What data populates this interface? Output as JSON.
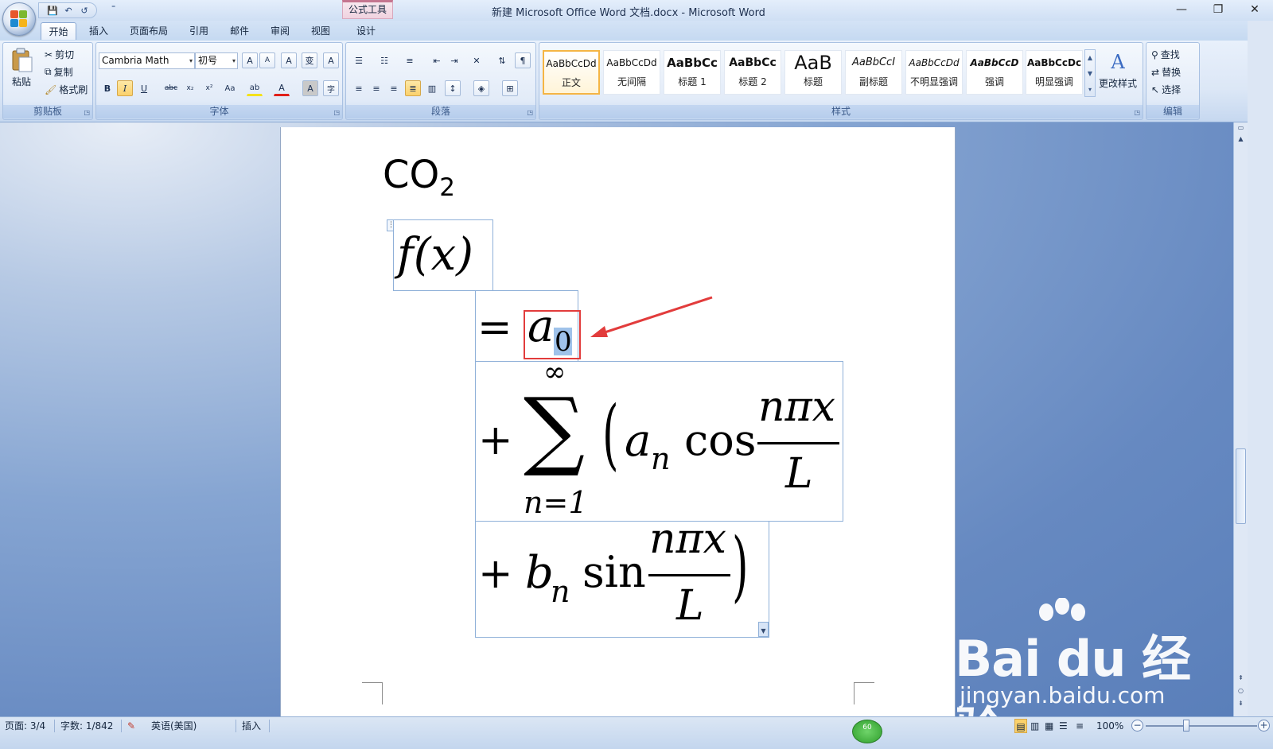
{
  "window": {
    "title": "新建 Microsoft Office Word 文档.docx - Microsoft Word",
    "context_tool": "公式工具",
    "controls": {
      "minimize": "—",
      "restore": "❐",
      "close": "✕"
    }
  },
  "qat": {
    "save": "💾",
    "undo": "↶",
    "redo": "↺",
    "more": "⁼"
  },
  "tabs": [
    {
      "label": "开始",
      "active": true
    },
    {
      "label": "插入"
    },
    {
      "label": "页面布局"
    },
    {
      "label": "引用"
    },
    {
      "label": "邮件"
    },
    {
      "label": "审阅"
    },
    {
      "label": "视图"
    },
    {
      "label": "设计",
      "context": true
    }
  ],
  "ribbon": {
    "clipboard": {
      "label": "剪贴板",
      "paste": "粘贴",
      "cut": "剪切",
      "copy": "复制",
      "format_painter": "格式刷"
    },
    "font": {
      "label": "字体",
      "font_name": "Cambria Math",
      "font_size": "初号",
      "bold": "B",
      "italic": "I",
      "underline": "U",
      "strike": "abc",
      "subscript": "x₂",
      "superscript": "x²",
      "change_case": "Aa",
      "grow": "A",
      "shrink": "A",
      "clear": "A",
      "phonetic": "变",
      "border_char": "A",
      "highlight": "ab",
      "font_color": "A",
      "shade_char": "A",
      "enclose": "字"
    },
    "paragraph": {
      "label": "段落"
    },
    "styles": {
      "label": "样式",
      "items": [
        {
          "preview": "AaBbCcDd",
          "label": "正文",
          "selected": true
        },
        {
          "preview": "AaBbCcDd",
          "label": "无间隔"
        },
        {
          "preview": "AaBbCc",
          "label": "标题 1"
        },
        {
          "preview": "AaBbCc",
          "label": "标题 2"
        },
        {
          "preview": "AaB",
          "label": "标题"
        },
        {
          "preview": "AaBbCcI",
          "label": "副标题"
        },
        {
          "preview": "AaBbCcDd",
          "label": "不明显强调"
        },
        {
          "preview": "AaBbCcD",
          "label": "强调"
        },
        {
          "preview": "AaBbCcDc",
          "label": "明显强调"
        }
      ],
      "change_styles": "更改样式"
    },
    "editing": {
      "label": "编辑",
      "find": "查找",
      "replace": "替换",
      "select": "选择"
    }
  },
  "document": {
    "co2_main": "CO",
    "co2_sub": "2",
    "equation": {
      "lhs": "f(x)",
      "eq": "=",
      "a": "a",
      "a_sub": "0",
      "plus": "+",
      "sum_top": "∞",
      "sum": "∑",
      "sum_bottom": "n=1",
      "lparen": "(",
      "an": "a",
      "an_sub": "n",
      "cos": "cos",
      "num": "nπx",
      "den": "L",
      "bn": "b",
      "bn_sub": "n",
      "sin": "sin",
      "rparen": ")"
    }
  },
  "watermark": {
    "brand": "Bai du 经验",
    "url": "jingyan.baidu.com"
  },
  "statusbar": {
    "page": "页面: 3/4",
    "words": "字数: 1/842",
    "language": "英语(美国)",
    "mode": "插入",
    "zoom": "100%",
    "badge": "60"
  }
}
